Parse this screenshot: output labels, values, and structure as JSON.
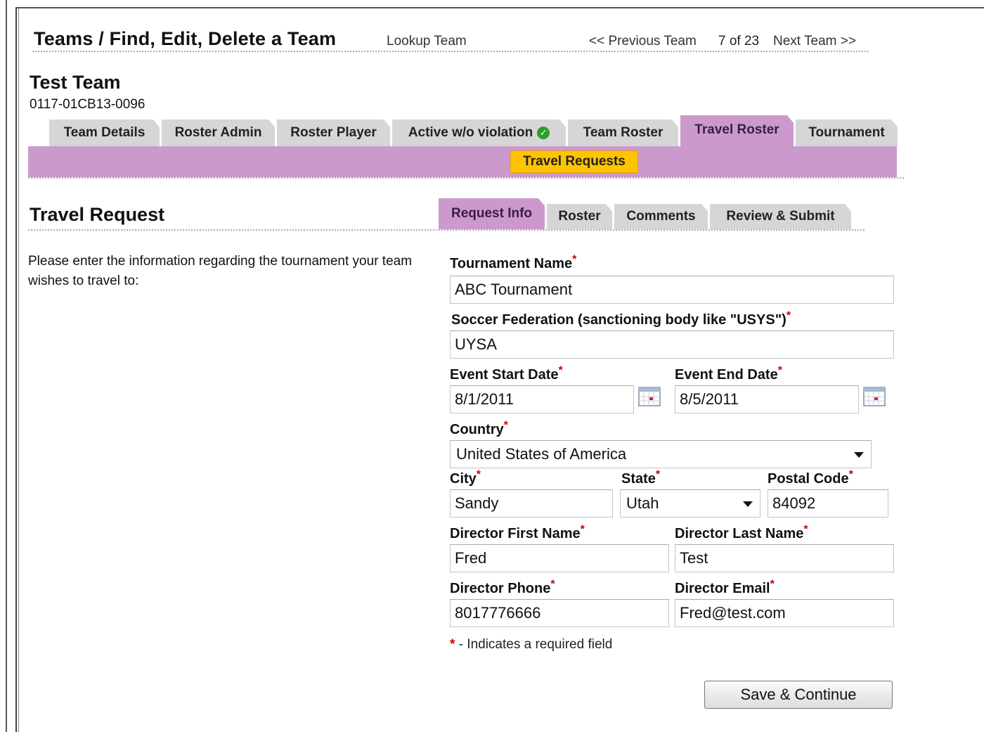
{
  "header": {
    "title": "Teams / Find, Edit, Delete a Team",
    "lookup_link": "Lookup Team",
    "prev_link": "<< Previous Team",
    "position": "7 of 23",
    "next_link": "Next Team >>"
  },
  "team": {
    "name": "Test Team",
    "code": "0117-01CB13-0096"
  },
  "main_tabs": [
    {
      "label": "Team Details",
      "active": false
    },
    {
      "label": "Roster Admin",
      "active": false
    },
    {
      "label": "Roster Player",
      "active": false
    },
    {
      "label": "Active w/o violation",
      "active": false,
      "status_icon": "check-circle-icon"
    },
    {
      "label": "Team Roster",
      "active": false
    },
    {
      "label": "Travel Roster",
      "active": true
    },
    {
      "label": "Tournament",
      "active": false
    }
  ],
  "sub_tab": {
    "label": "Travel Requests",
    "active": true
  },
  "travel_request": {
    "title": "Travel Request",
    "intro": "Please enter the information regarding the tournament your team wishes to travel to:",
    "tabs": [
      {
        "label": "Request Info",
        "active": true
      },
      {
        "label": "Roster",
        "active": false
      },
      {
        "label": "Comments",
        "active": false
      },
      {
        "label": "Review & Submit",
        "active": false
      }
    ]
  },
  "form": {
    "required_marker": "*",
    "tournament_name": {
      "label": "Tournament Name",
      "value": "ABC Tournament"
    },
    "federation": {
      "label": "Soccer Federation (sanctioning body like \"USYS\")",
      "value": "UYSA"
    },
    "start_date": {
      "label": "Event Start Date",
      "value": "8/1/2011"
    },
    "end_date": {
      "label": "Event End Date",
      "value": "8/5/2011"
    },
    "country": {
      "label": "Country",
      "value": "United States of America"
    },
    "city": {
      "label": "City",
      "value": "Sandy"
    },
    "state": {
      "label": "State",
      "value": "Utah"
    },
    "postal_code": {
      "label": "Postal Code",
      "value": "84092"
    },
    "director_first": {
      "label": "Director First Name",
      "value": "Fred"
    },
    "director_last": {
      "label": "Director Last Name",
      "value": "Test"
    },
    "director_phone": {
      "label": "Director Phone",
      "value": "8017776666"
    },
    "director_email": {
      "label": "Director Email",
      "value": "Fred@test.com"
    },
    "required_note": "- Indicates a required field",
    "save_button": "Save & Continue"
  },
  "colors": {
    "active_tab": "#cc99cc",
    "subtab_highlight": "#ffc400",
    "inactive_tab": "#d6d6d6",
    "required": "#cc0000"
  }
}
